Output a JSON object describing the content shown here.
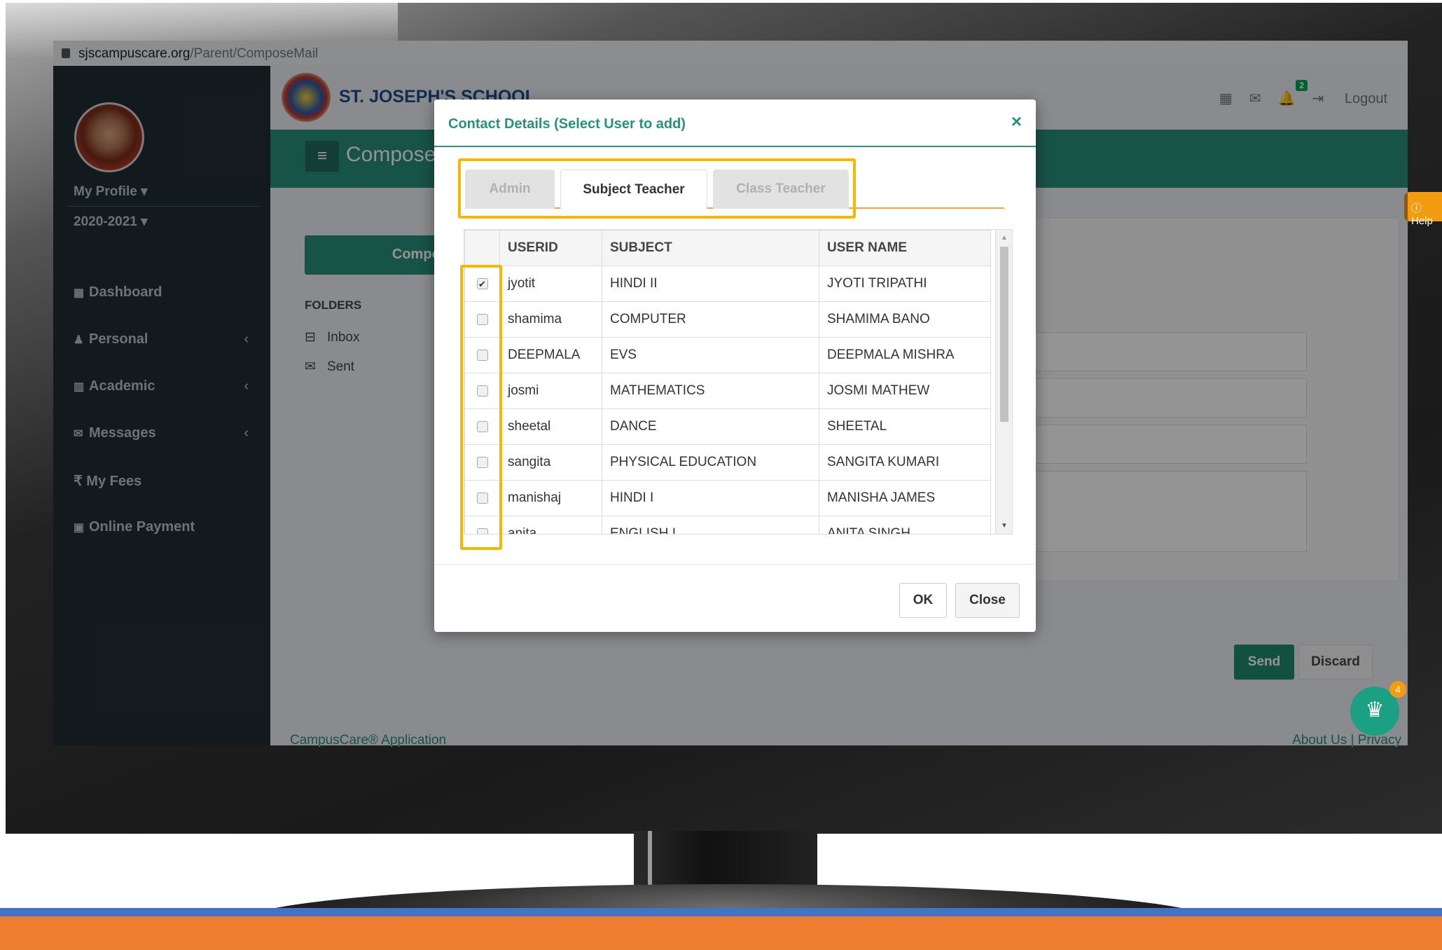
{
  "browser": {
    "host": "sjscampuscare.org",
    "path": "/Parent/ComposeMail"
  },
  "sidebar": {
    "profile_label": "My Profile",
    "year_label": "2020-2021",
    "items": [
      {
        "label": "Dashboard",
        "icon": "dashboard-icon"
      },
      {
        "label": "Personal",
        "icon": "user-icon"
      },
      {
        "label": "Academic",
        "icon": "institution-icon"
      },
      {
        "label": "Messages",
        "icon": "envelope-icon"
      },
      {
        "label": "₹ My Fees",
        "icon": "rupee-icon"
      },
      {
        "label": "Online Payment",
        "icon": "money-icon"
      }
    ]
  },
  "header": {
    "school_name": "ST. JOSEPH'S SCHOOL",
    "page_title": "Compose",
    "logout_label": "Logout",
    "notification_count": "2",
    "help_label": "Help"
  },
  "mailbox": {
    "compose_label": "Compose",
    "folders_label": "FOLDERS",
    "inbox_label": "Inbox",
    "sent_label": "Sent",
    "send_label": "Send",
    "discard_label": "Discard",
    "chat_count": "4"
  },
  "footer": {
    "left": "CampusCare® Application",
    "right": "About Us | Privacy"
  },
  "modal": {
    "title": "Contact Details (Select User to add)",
    "close_symbol": "×",
    "tabs": [
      {
        "label": "Admin",
        "active": false
      },
      {
        "label": "Subject Teacher",
        "active": true
      },
      {
        "label": "Class Teacher",
        "active": false
      }
    ],
    "columns": [
      "USERID",
      "SUBJECT",
      "USER NAME"
    ],
    "rows": [
      {
        "checked": true,
        "userid": "jyotit",
        "subject": "HINDI II",
        "username": "JYOTI TRIPATHI"
      },
      {
        "checked": false,
        "userid": "shamima",
        "subject": "COMPUTER",
        "username": "SHAMIMA BANO"
      },
      {
        "checked": false,
        "userid": "DEEPMALA",
        "subject": "EVS",
        "username": "DEEPMALA MISHRA"
      },
      {
        "checked": false,
        "userid": "josmi",
        "subject": "MATHEMATICS",
        "username": "JOSMI MATHEW"
      },
      {
        "checked": false,
        "userid": "sheetal",
        "subject": "DANCE",
        "username": "SHEETAL"
      },
      {
        "checked": false,
        "userid": "sangita",
        "subject": "PHYSICAL EDUCATION",
        "username": "SANGITA KUMARI"
      },
      {
        "checked": false,
        "userid": "manishaj",
        "subject": "HINDI I",
        "username": "MANISHA JAMES"
      },
      {
        "checked": false,
        "userid": "anita",
        "subject": "ENGLISH I",
        "username": "ANITA SINGH"
      }
    ],
    "ok_label": "OK",
    "close_label": "Close"
  },
  "colors": {
    "teal": "#2a8f7c",
    "sidebar": "#222d32",
    "highlight": "#f5b800",
    "slide_blue": "#4472c4",
    "slide_orange": "#ed7d31"
  }
}
